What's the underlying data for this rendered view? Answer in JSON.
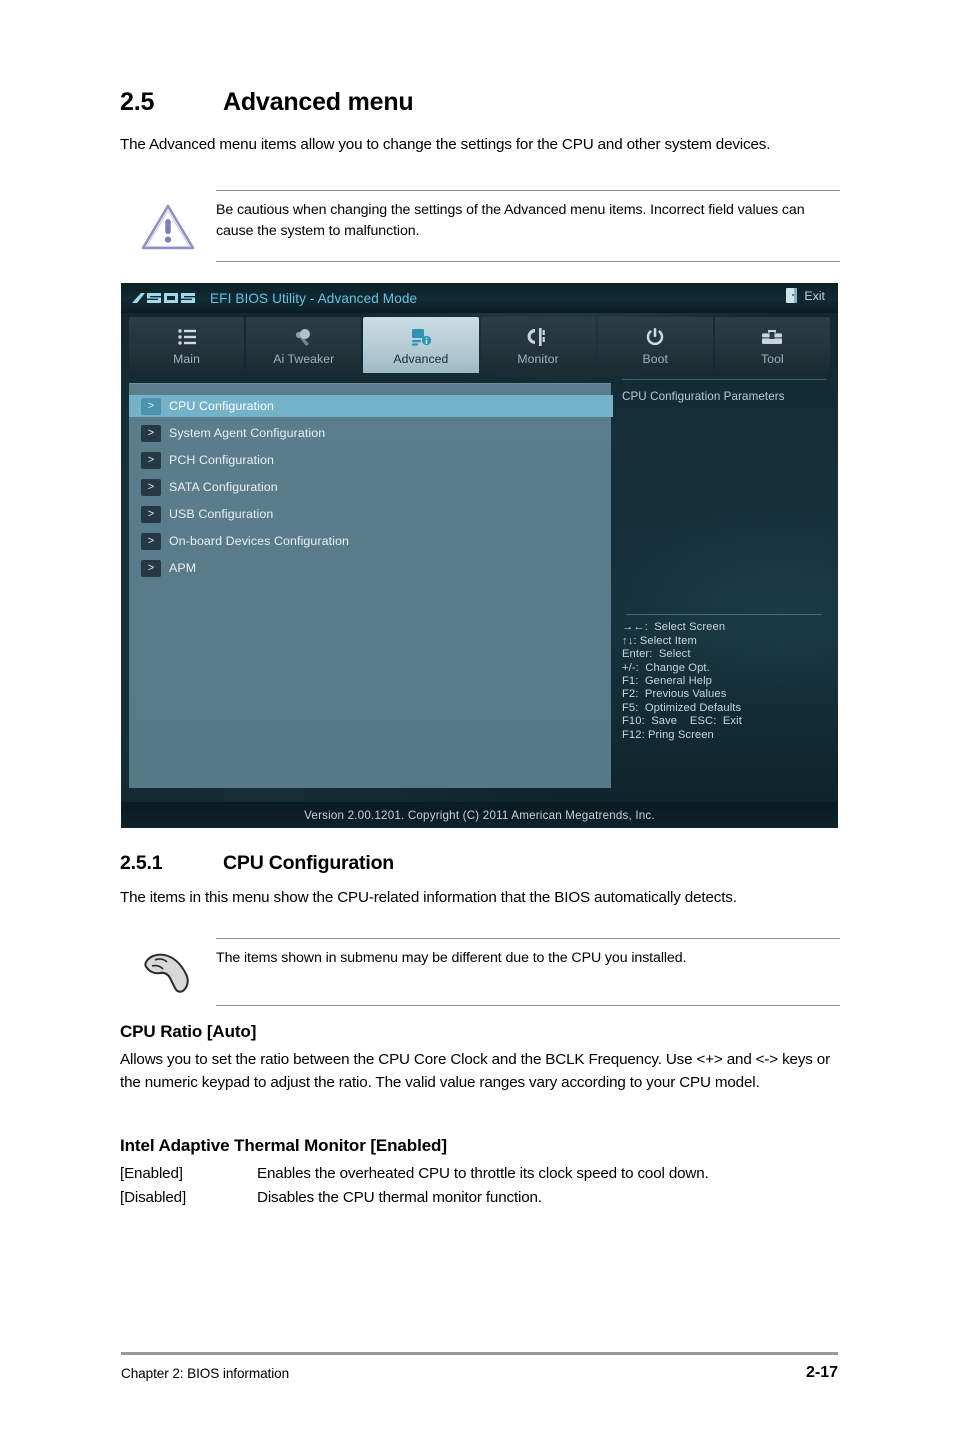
{
  "document": {
    "section": {
      "number": "2.5",
      "title": "Advanced menu"
    },
    "intro": "The Advanced menu items allow you to change the settings for the CPU and other system devices.",
    "warning_note": "Be cautious when changing the settings of the Advanced menu items. Incorrect field values can cause the system to malfunction.",
    "subsection": {
      "number": "2.5.1",
      "title": "CPU Configuration"
    },
    "subsection_intro": "The items in this menu show the CPU-related information that the BIOS automatically detects.",
    "info_note": "The items shown in submenu may be different due to the CPU you installed.",
    "options": [
      {
        "title": "CPU Ratio [Auto]",
        "description": "Allows you to set the ratio between the CPU Core Clock and the BCLK Frequency. Use <+> and <-> keys or the numeric keypad to adjust the ratio. The valid value ranges vary according to your CPU model.",
        "definitions": []
      },
      {
        "title": "Intel Adaptive Thermal Monitor [Enabled]",
        "description": "",
        "definitions": [
          {
            "key": "[Enabled]",
            "value": "Enables the overheated CPU to throttle its clock speed to cool down."
          },
          {
            "key": "[Disabled]",
            "value": "Disables the CPU thermal monitor function."
          }
        ]
      }
    ],
    "footer": {
      "left": "Chapter 2: BIOS information",
      "right": "2-17"
    }
  },
  "bios": {
    "brand": "ASUS",
    "title": "EFI BIOS Utility - Advanced Mode",
    "exit_label": "Exit",
    "tabs": [
      {
        "label": "Main",
        "icon": "list-icon",
        "active": false
      },
      {
        "label": "Ai  Tweaker",
        "icon": "tuner-icon",
        "active": false
      },
      {
        "label": "Advanced",
        "icon": "chip-icon",
        "active": true
      },
      {
        "label": "Monitor",
        "icon": "monitor-icon",
        "active": false
      },
      {
        "label": "Boot",
        "icon": "power-icon",
        "active": false
      },
      {
        "label": "Tool",
        "icon": "toolbox-icon",
        "active": false
      }
    ],
    "menu_items": [
      {
        "label": "CPU Configuration",
        "selected": true
      },
      {
        "label": "System Agent Configuration",
        "selected": false
      },
      {
        "label": "PCH Configuration",
        "selected": false
      },
      {
        "label": "SATA Configuration",
        "selected": false
      },
      {
        "label": "USB Configuration",
        "selected": false
      },
      {
        "label": "On-board Devices Configuration",
        "selected": false
      },
      {
        "label": "APM",
        "selected": false
      }
    ],
    "help_text": "CPU Configuration Parameters",
    "key_legend": [
      "→←:  Select Screen",
      "↑↓: Select Item",
      "Enter:  Select",
      "+/-:  Change Opt.",
      "F1:  General Help",
      "F2:  Previous Values",
      "F5:  Optimized Defaults",
      "F10:  Save    ESC:  Exit",
      "F12: Pring Screen"
    ],
    "version_footer": "Version  2.00.1201.   Copyright  (C)  2011  American  Megatrends,  Inc.",
    "colors": {
      "accent": "#61c3e0",
      "panel": "#5a7c8a",
      "highlight": "#74b2c9"
    }
  }
}
